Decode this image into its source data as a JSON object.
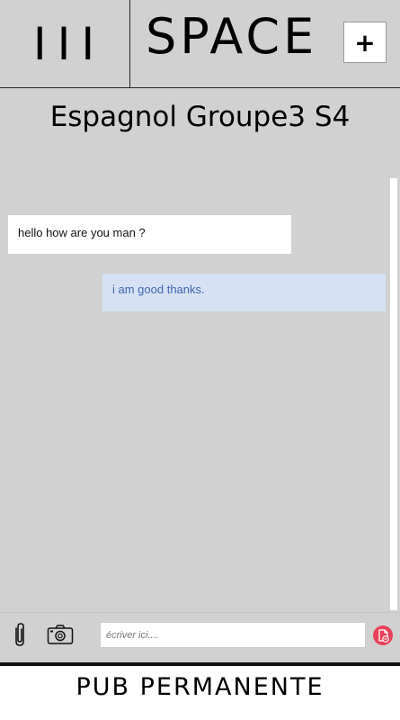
{
  "header": {
    "menu_glyph": "III",
    "brand": "SPACE",
    "add_label": "+"
  },
  "conversation": {
    "title": "Espagnol Groupe3 S4",
    "messages": [
      {
        "from": "other",
        "text": "hello how are you man ?"
      },
      {
        "from": "me",
        "text": "i am good thanks."
      }
    ]
  },
  "composer": {
    "placeholder": "écriver ici....",
    "value": "",
    "icons": {
      "attach": "paperclip-icon",
      "camera": "camera-icon",
      "send": "send-icon"
    }
  },
  "ad": {
    "label": "PUB PERMANENTE"
  },
  "colors": {
    "background": "#d1d1d1",
    "sent_bubble": "#d6e1f4",
    "sent_text": "#3f66ad",
    "received_bubble": "#ffffff",
    "send_button": "#e8405a"
  }
}
